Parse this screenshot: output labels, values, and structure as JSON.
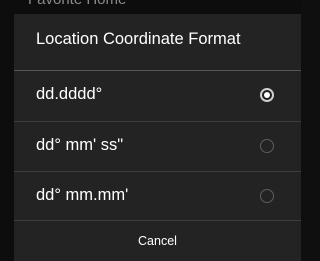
{
  "background": {
    "text": "Favorite Home"
  },
  "dialog": {
    "title": "Location Coordinate Format",
    "options": [
      {
        "label": "dd.dddd°",
        "selected": true
      },
      {
        "label": "dd° mm' ss\"",
        "selected": false
      },
      {
        "label": "dd° mm.mm'",
        "selected": false
      }
    ],
    "cancel_label": "Cancel"
  },
  "colors": {
    "dialog_background": "#232323",
    "screen_background": "#0d0d0d",
    "text": "#ffffff",
    "selected_radio": "#cfcfcf",
    "unselected_radio": "#5e5e5e"
  }
}
